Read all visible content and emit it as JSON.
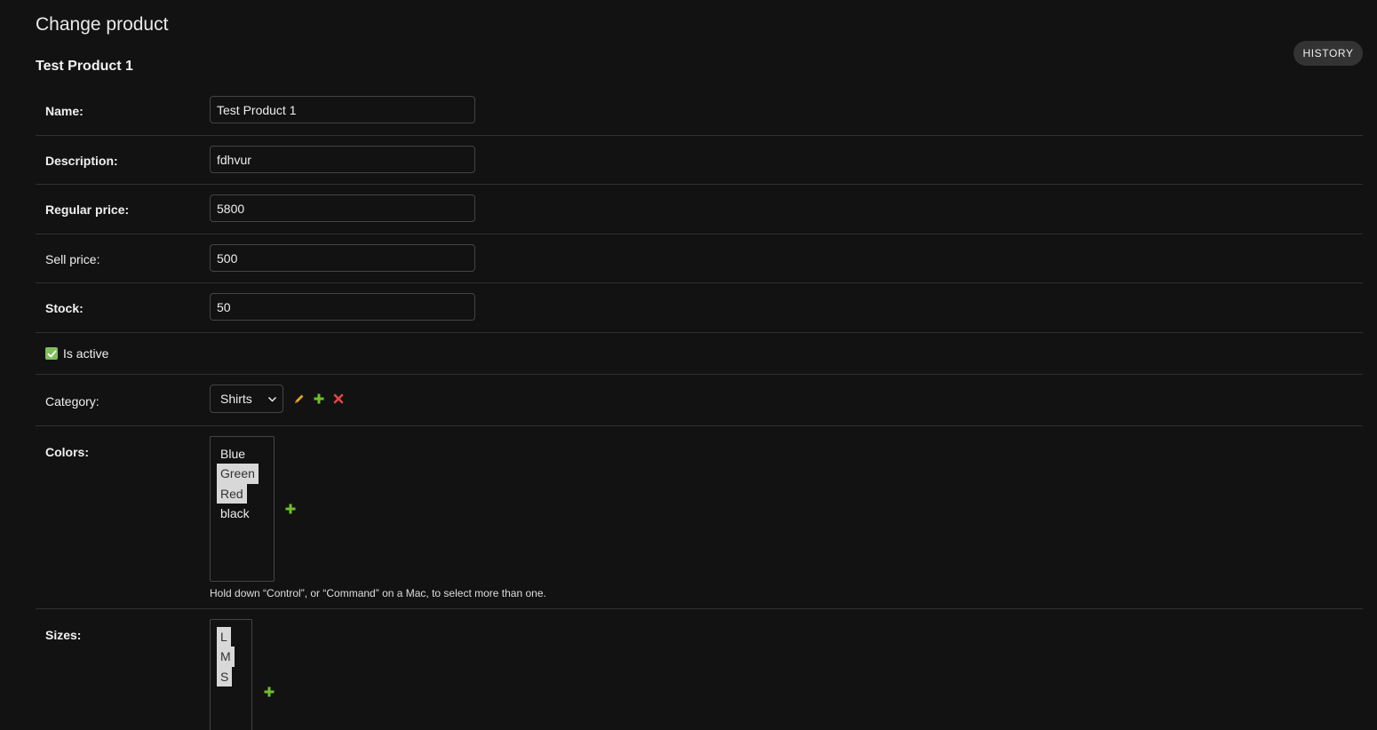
{
  "header": {
    "title": "Change product",
    "history_label": "HISTORY"
  },
  "object": {
    "title": "Test Product 1"
  },
  "form": {
    "name": {
      "label": "Name:",
      "value": "Test Product 1"
    },
    "description": {
      "label": "Description:",
      "value": "fdhvur"
    },
    "regular_price": {
      "label": "Regular price:",
      "value": "5800"
    },
    "sell_price": {
      "label": "Sell price:",
      "value": "500"
    },
    "stock": {
      "label": "Stock:",
      "value": "50"
    },
    "is_active": {
      "label": "Is active",
      "checked": true
    },
    "category": {
      "label": "Category:",
      "selected": "Shirts"
    },
    "colors": {
      "label": "Colors:",
      "options": [
        {
          "label": "Blue",
          "selected": false
        },
        {
          "label": "Green",
          "selected": true
        },
        {
          "label": "Red",
          "selected": true
        },
        {
          "label": "black",
          "selected": false
        }
      ],
      "help": "Hold down “Control”, or “Command” on a Mac, to select more than one."
    },
    "sizes": {
      "label": "Sizes:",
      "options": [
        {
          "label": "L",
          "selected": true
        },
        {
          "label": "M",
          "selected": true
        },
        {
          "label": "S",
          "selected": true
        }
      ]
    }
  },
  "colors": {
    "background": "#121212",
    "checkbox_accent": "#7fbf5a",
    "edit_icon": "#e0a526",
    "add_icon": "#70bf2b",
    "delete_icon": "#dd4646"
  },
  "icons": {
    "edit": "pencil-icon",
    "add": "plus-icon",
    "delete": "x-icon",
    "dropdown": "chevron-down-icon",
    "checked": "check-icon"
  }
}
